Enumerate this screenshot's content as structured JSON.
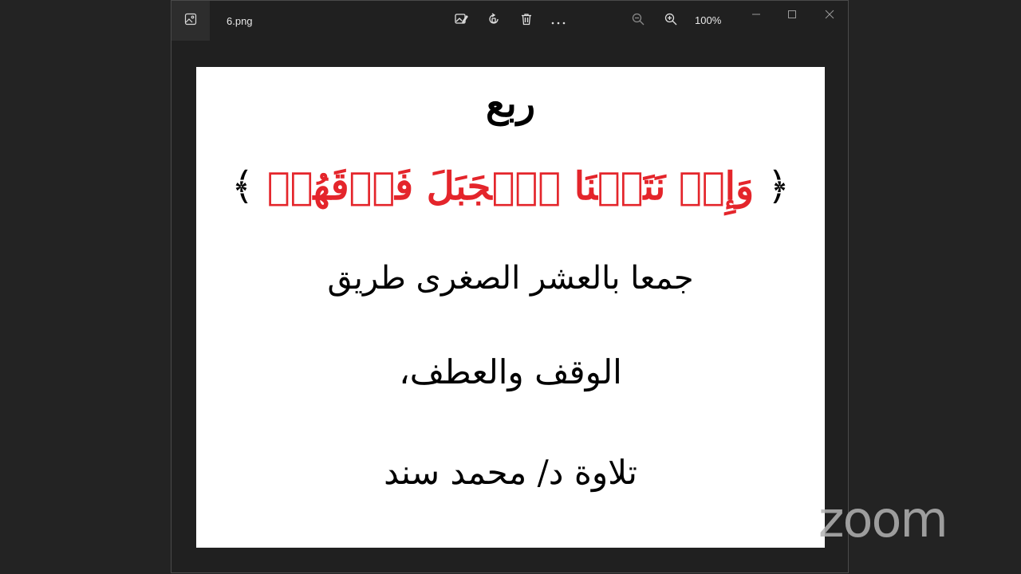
{
  "window": {
    "filename": "6.png",
    "zoom_level": "100%"
  },
  "toolbar": {
    "icons": [
      "image-icon",
      "edit-image-icon",
      "rotate-icon",
      "delete-icon",
      "more-icon",
      "zoom-out-icon",
      "zoom-in-icon"
    ]
  },
  "window_controls": [
    "minimize-icon",
    "maximize-icon",
    "close-icon"
  ],
  "image_content": {
    "line1": "ربع",
    "line2_verse": "وَإِذۡ نَتَقۡنَا ٱلۡجَبَلَ فَوۡقَهُمۡ",
    "line2_open_bracket": "﴿",
    "line2_close_bracket": "﴾",
    "line3": "جمعا بالعشر الصغرى طريق",
    "line4": "الوقف والعطف،",
    "line5": "تلاوة د/ محمد سند",
    "verse_color": "#e4252b"
  },
  "watermark": {
    "text": "zoom"
  }
}
